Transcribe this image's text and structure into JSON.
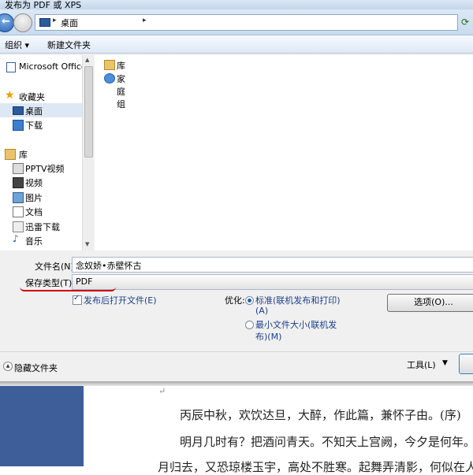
{
  "window": {
    "title": "发布为 PDF 或 XPS"
  },
  "address": {
    "path": "桌面"
  },
  "toolbar": {
    "organize": "组织 ▾",
    "new_folder": "新建文件夹"
  },
  "nav": {
    "items": [
      {
        "label": "Microsoft Office",
        "icon": "office-icon"
      },
      {
        "label": "收藏夹",
        "icon": "star-icon"
      },
      {
        "label": "桌面",
        "icon": "desktop-icon"
      },
      {
        "label": "下载",
        "icon": "download-icon"
      },
      {
        "label": "库",
        "icon": "library-icon"
      },
      {
        "label": "PPTV视频",
        "icon": "video-icon"
      },
      {
        "label": "视频",
        "icon": "video-icon"
      },
      {
        "label": "图片",
        "icon": "picture-icon"
      },
      {
        "label": "文档",
        "icon": "document-icon"
      },
      {
        "label": "迅雷下载",
        "icon": "download-icon"
      },
      {
        "label": "音乐",
        "icon": "music-icon"
      }
    ]
  },
  "files": [
    {
      "label": "库",
      "icon": "library-icon"
    },
    {
      "label": "家庭组",
      "icon": "homegroup-icon"
    }
  ],
  "form": {
    "filename_label": "文件名(N):",
    "filename_value": "念奴娇•赤壁怀古",
    "type_label": "保存类型(T):",
    "type_value": "PDF",
    "open_after_label": "发布后打开文件(E)",
    "optimize_label": "优化:",
    "opt1_line1": "标准(联机发布和打印)",
    "opt1_line2": "(A)",
    "opt2_line1": "最小文件大小(联机发",
    "opt2_line2": "布)(M)",
    "options_button": "选项(O)..."
  },
  "bottom": {
    "hide_folders": "隐藏文件夹",
    "tools": "工具(L)"
  },
  "document": {
    "line1": "丙辰中秋，欢饮达旦，大醉，作此篇，兼怀子由。(序)",
    "line2": "明月几时有？把酒问青天。不知天上宫阙，今夕是何年。",
    "line3": "月归去，又恐琼楼玉宇，高处不胜寒。起舞弄清影，何似在人"
  }
}
